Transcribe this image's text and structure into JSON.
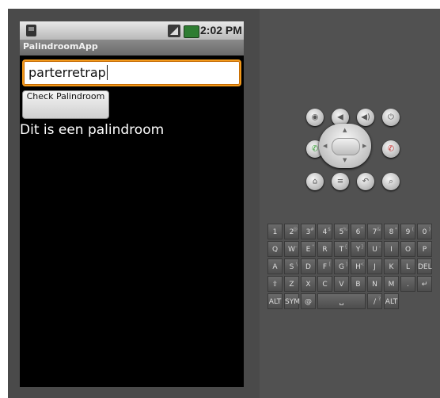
{
  "status_bar": {
    "time": "2:02 PM"
  },
  "app": {
    "title": "PalindroomApp"
  },
  "edit_text": {
    "value": "parterretrap"
  },
  "button": {
    "label": "Check Palindroom"
  },
  "result": {
    "text": "Dit is een palindroom"
  },
  "hardware_buttons": [
    "camera-icon",
    "volume-down-icon",
    "volume-up-icon",
    "power-icon",
    "call-icon",
    "end-call-icon",
    "home-icon",
    "menu-icon",
    "back-icon",
    "search-icon"
  ],
  "keyboard": {
    "rows": [
      [
        "1",
        "2",
        "3",
        "4",
        "5",
        "6",
        "7",
        "8",
        "9",
        "0"
      ],
      [
        "Q",
        "W",
        "E",
        "R",
        "T",
        "Y",
        "U",
        "I",
        "O",
        "P"
      ],
      [
        "A",
        "S",
        "D",
        "F",
        "G",
        "H",
        "J",
        "K",
        "L",
        "DEL"
      ],
      [
        "⇧",
        "Z",
        "X",
        "C",
        "V",
        "B",
        "N",
        "M",
        ".",
        "↵"
      ],
      [
        "ALT",
        "SYM",
        "@",
        "␣",
        "/",
        "ALT"
      ]
    ],
    "secondary": [
      [
        "",
        "@",
        "#",
        "$",
        "%",
        "^",
        "&",
        "*",
        "(",
        ")"
      ],
      [
        "",
        "~",
        "\"",
        "",
        "{",
        "}",
        "-",
        "",
        "",
        ""
      ],
      [
        "",
        "\\",
        "",
        "[",
        "]",
        "<",
        "",
        "",
        ""
      ],
      [
        "",
        "",
        "",
        "",
        "",
        "",
        "",
        "",
        "",
        ""
      ],
      [
        "",
        "",
        "",
        "",
        "?",
        ""
      ]
    ]
  }
}
